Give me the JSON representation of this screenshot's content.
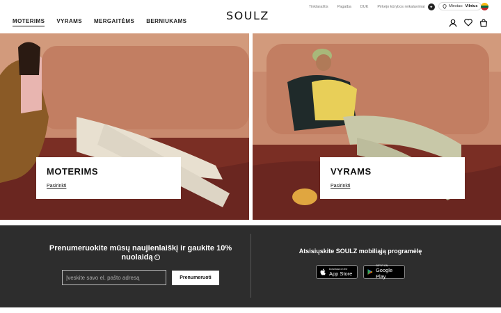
{
  "header": {
    "logo": "SOULZ",
    "nav": [
      "MOTERIMS",
      "VYRAMS",
      "MERGAITĖMS",
      "BERNIUKAMS"
    ],
    "toplinks": [
      "Tinklaraštis",
      "Pagalba",
      "DUK",
      "Pirkėjo kūrybos reikalavimai"
    ],
    "city_label": "Miestas:",
    "city_value": "Vilnius",
    "flag_colors": [
      "#fdb913",
      "#006a44",
      "#c1272d"
    ]
  },
  "hero": {
    "left": {
      "title": "MOTERIMS",
      "link": "Pasirinkti"
    },
    "right": {
      "title": "VYRAMS",
      "link": "Pasirinkti"
    }
  },
  "newsletter": {
    "title": "Prenumeruokite mūsų naujienlaiškį ir gaukite 10% nuolaidą",
    "email_placeholder": "Įveskite savo el. pašto adresą",
    "button": "Prenumeruoti"
  },
  "app": {
    "title": "Atsisiųskite SOULZ mobiliąją programėlę",
    "apple_small": "Download on the",
    "apple_big": "App Store",
    "google_small": "GET IT ON",
    "google_big": "Google Play"
  },
  "colors": {
    "footer_bg": "#2d2d2d",
    "sofa": "#c98a6e",
    "rug": "#7a2e24"
  }
}
